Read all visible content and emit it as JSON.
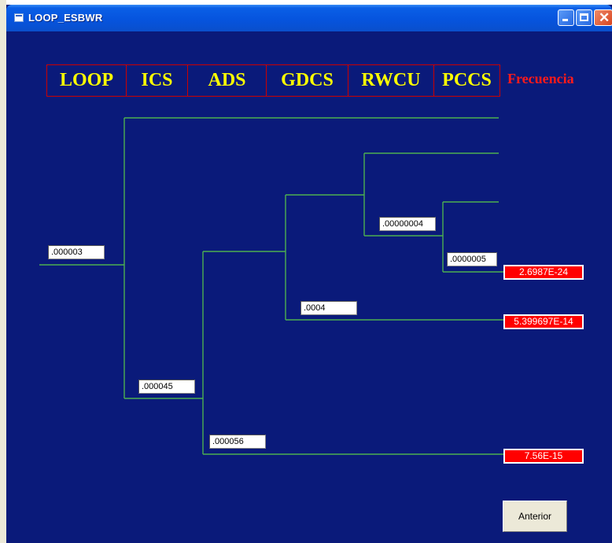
{
  "window": {
    "title": "LOOP_ESBWR"
  },
  "header": {
    "columns": [
      "LOOP",
      "ICS",
      "ADS",
      "GDCS",
      "RWCU",
      "PCCS"
    ],
    "frequency_label": "Frecuencia"
  },
  "probabilities": {
    "loop": ".000003",
    "ics": ".000045",
    "ads": ".000056",
    "gdcs": ".0004",
    "rwcu": ".00000004",
    "pccs": ".0000005"
  },
  "results": {
    "r1": "2.6987E-24",
    "r2": "5.399697E-14",
    "r3": "7.56E-15"
  },
  "buttons": {
    "anterior": "Anterior"
  },
  "colors": {
    "background": "#0a1a7a",
    "branch_line": "#4caf50",
    "header_text": "#ffff00",
    "header_border": "#cc0000",
    "frequency_label": "#ff1a1a",
    "result_fill": "#ff0000"
  }
}
